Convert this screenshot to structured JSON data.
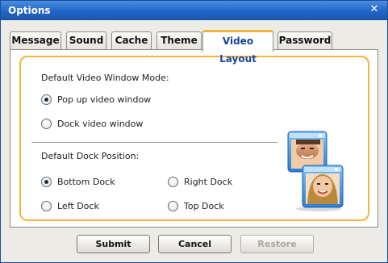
{
  "window": {
    "title": "Options",
    "close_icon": "close-icon"
  },
  "tabs": [
    {
      "label": "Message"
    },
    {
      "label": "Sound"
    },
    {
      "label": "Cache"
    },
    {
      "label": "Theme"
    },
    {
      "label": "Video Layout",
      "active": true
    },
    {
      "label": "Password"
    }
  ],
  "video_mode": {
    "heading": "Default Video Window Mode:",
    "options": [
      {
        "label": "Pop up video window",
        "selected": true
      },
      {
        "label": "Dock video window",
        "selected": false
      }
    ]
  },
  "dock_position": {
    "heading": "Default Dock Position:",
    "options": [
      {
        "label": "Bottom Dock",
        "selected": true
      },
      {
        "label": "Right Dock",
        "selected": false
      },
      {
        "label": "Left Dock",
        "selected": false
      },
      {
        "label": "Top Dock",
        "selected": false
      }
    ]
  },
  "illustration": {
    "icon": "video-windows-icon"
  },
  "buttons": {
    "submit": "Submit",
    "cancel": "Cancel",
    "restore": "Restore"
  },
  "colors": {
    "titlebar": "#2266c8",
    "accent": "#f3b53c",
    "active_tab_text": "#14469c"
  }
}
